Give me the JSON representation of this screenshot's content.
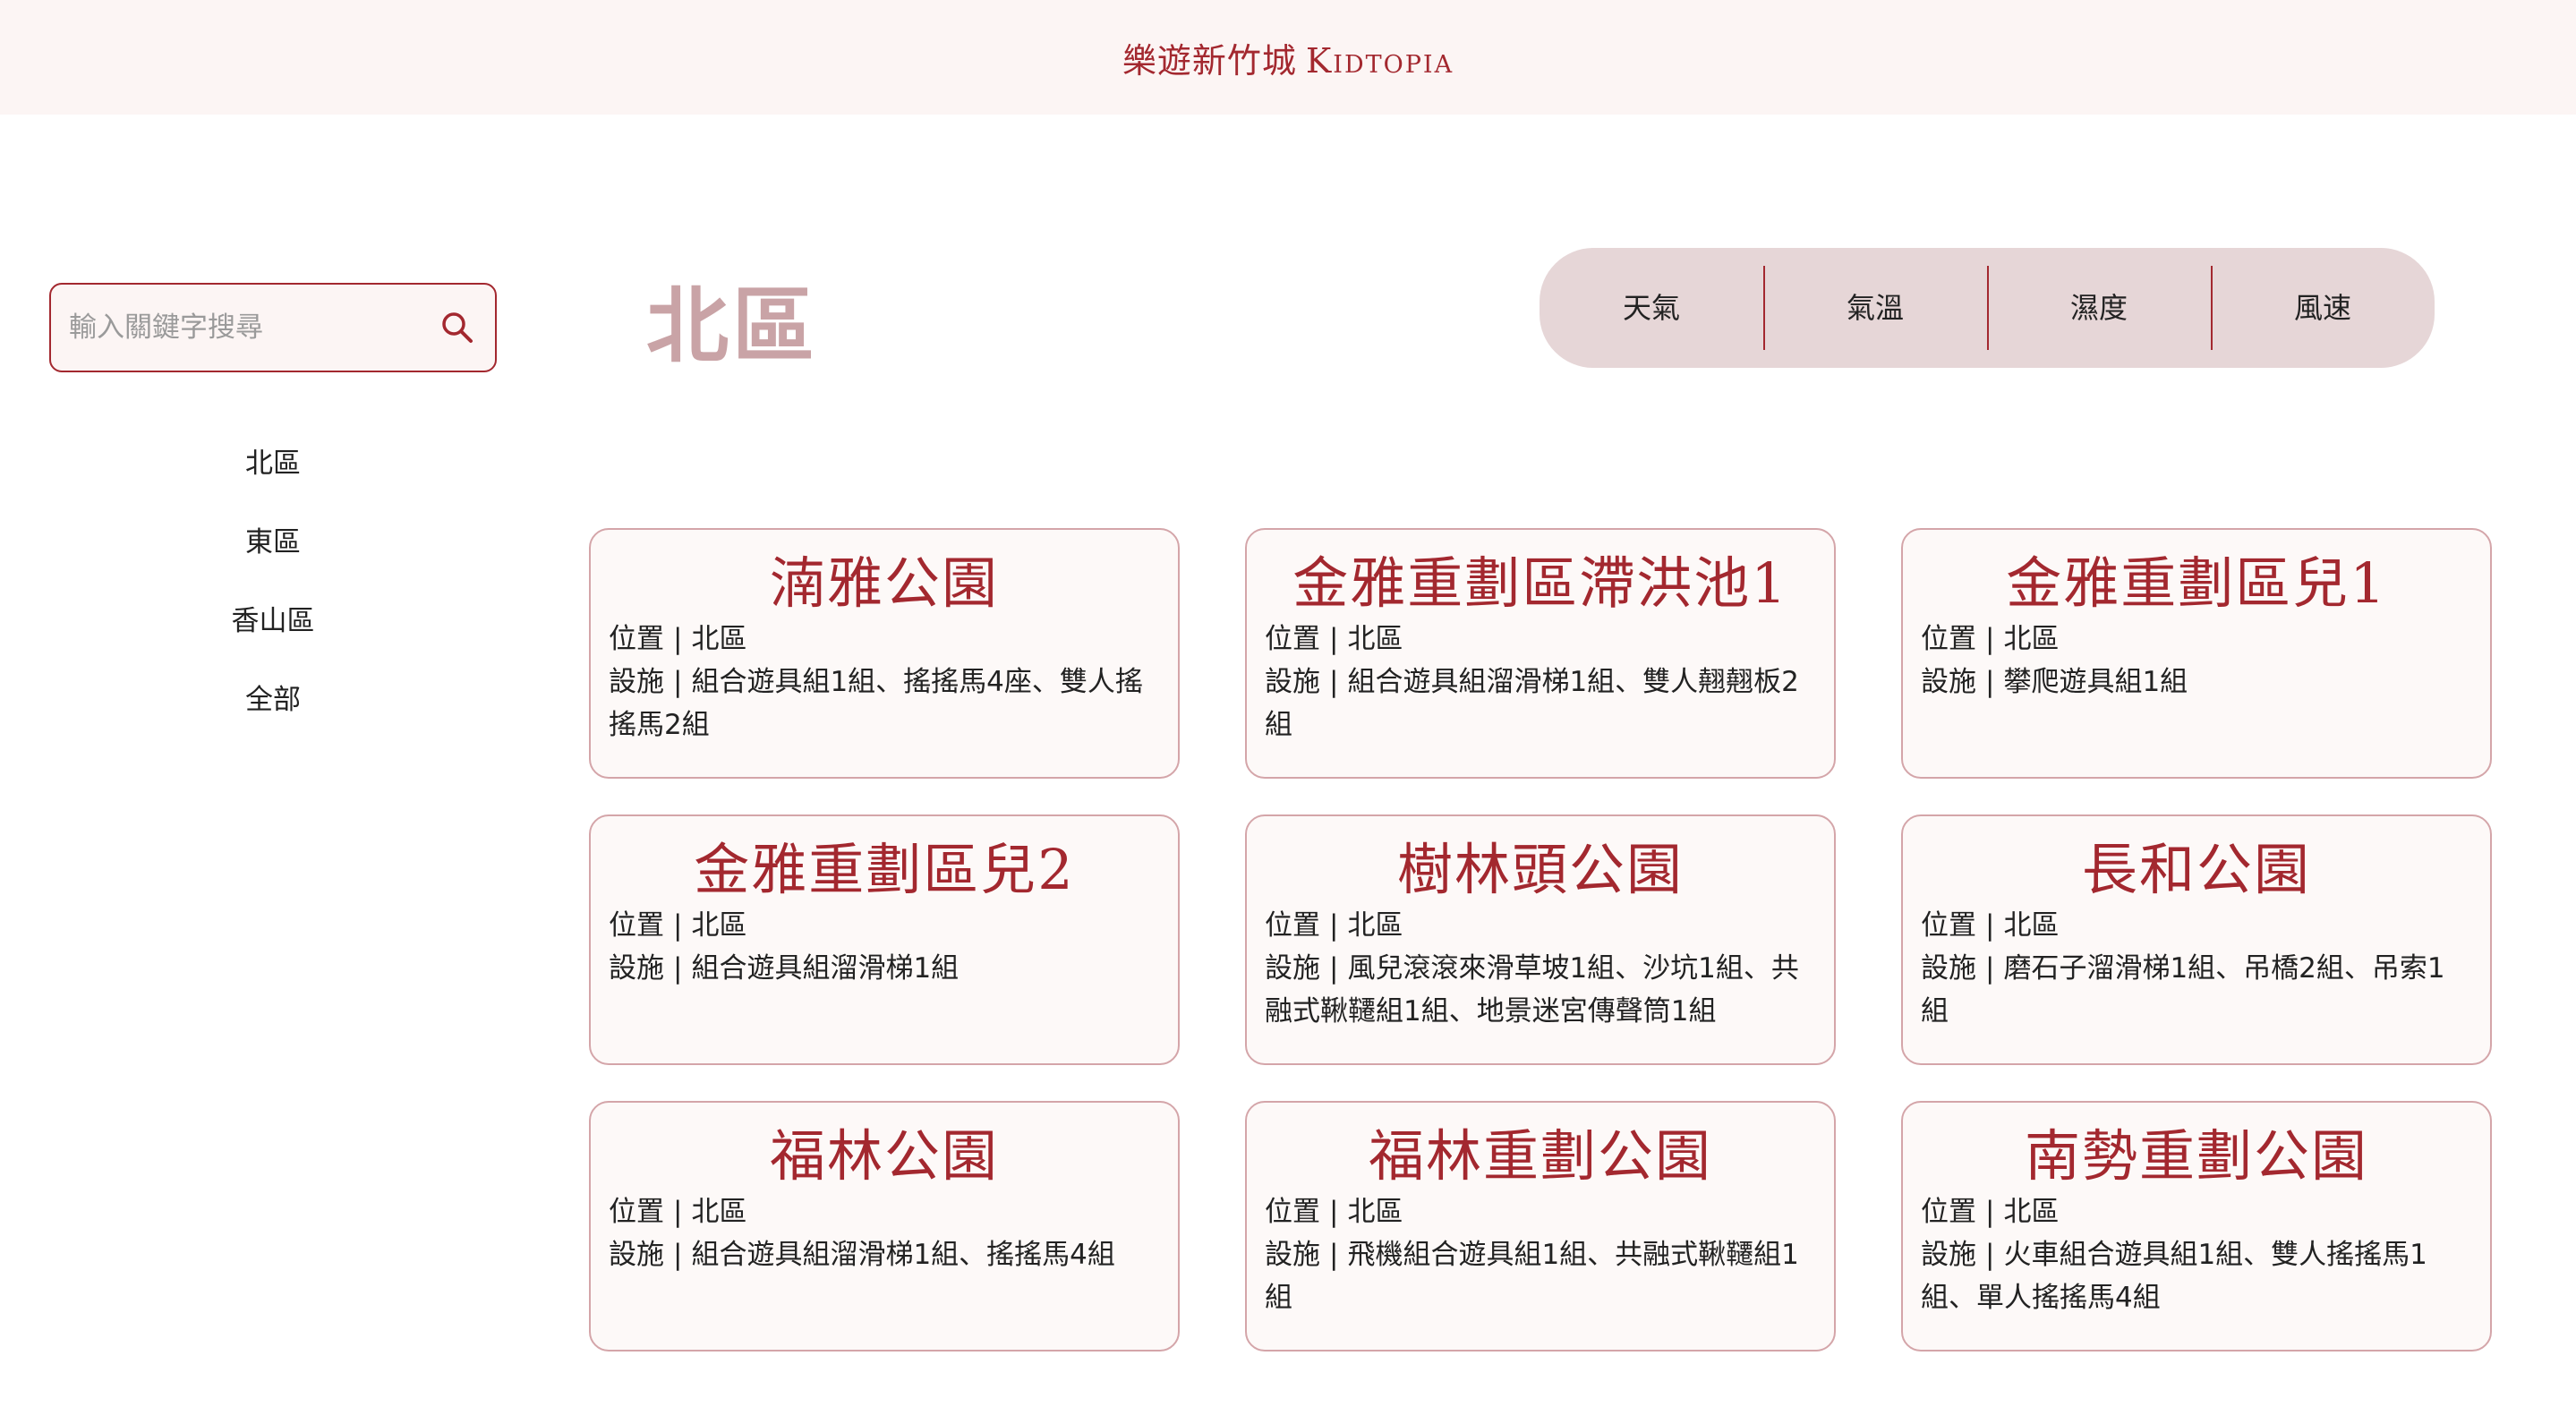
{
  "header": {
    "brand_zh": "樂遊新竹城",
    "brand_en": "Kidtopia"
  },
  "search": {
    "placeholder": "輸入關鍵字搜尋",
    "icon": "search-icon"
  },
  "sidebar": {
    "items": [
      {
        "label": "北區"
      },
      {
        "label": "東區"
      },
      {
        "label": "香山區"
      },
      {
        "label": "全部"
      }
    ]
  },
  "main": {
    "region_title": "北區",
    "weather": {
      "weather_label": "天氣",
      "temp_label": "氣溫",
      "humidity_label": "濕度",
      "wind_label": "風速"
    },
    "location_label": "位置",
    "facilities_label": "設施",
    "parks": [
      {
        "name": "湳雅公園",
        "location": "北區",
        "facilities": "組合遊具組1組、搖搖馬4座、雙人搖搖馬2組"
      },
      {
        "name": "金雅重劃區滯洪池1",
        "location": "北區",
        "facilities": "組合遊具組溜滑梯1組、雙人翹翹板2組"
      },
      {
        "name": "金雅重劃區兒1",
        "location": "北區",
        "facilities": "攀爬遊具組1組"
      },
      {
        "name": "金雅重劃區兒2",
        "location": "北區",
        "facilities": "組合遊具組溜滑梯1組"
      },
      {
        "name": "樹林頭公園",
        "location": "北區",
        "facilities": "風兒滾滾來滑草坡1組、沙坑1組、共融式鞦韆組1組、地景迷宮傳聲筒1組"
      },
      {
        "name": "長和公園",
        "location": "北區",
        "facilities": "磨石子溜滑梯1組、吊橋2組、吊索1組"
      },
      {
        "name": "福林公園",
        "location": "北區",
        "facilities": "組合遊具組溜滑梯1組、搖搖馬4組"
      },
      {
        "name": "福林重劃公園",
        "location": "北區",
        "facilities": "飛機組合遊具組1組、共融式鞦韆組1組"
      },
      {
        "name": "南勢重劃公園",
        "location": "北區",
        "facilities": "火車組合遊具組1組、雙人搖搖馬1組、單人搖搖馬4組"
      }
    ]
  },
  "colors": {
    "accent": "#a3282f",
    "header_bg": "#fcf5f4",
    "weather_bg": "#e6d6d7",
    "region_title": "#c9a3a6"
  }
}
